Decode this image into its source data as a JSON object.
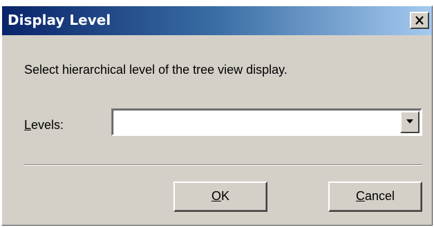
{
  "window": {
    "title": "Display Level",
    "close_icon": "close-icon"
  },
  "dialog": {
    "description": "Select hierarchical level of the tree view display.",
    "levels_label_mnemonic": "L",
    "levels_label_rest": "evels:",
    "levels_value": "",
    "dropdown_icon": "chevron-down-icon"
  },
  "buttons": {
    "ok_mnemonic": "O",
    "ok_rest": "K",
    "cancel_mnemonic": "C",
    "cancel_rest": "ancel"
  },
  "colors": {
    "titlebar_start": "#0a246a",
    "titlebar_end": "#a6caf0",
    "dialog_background": "#d4d0c8"
  }
}
